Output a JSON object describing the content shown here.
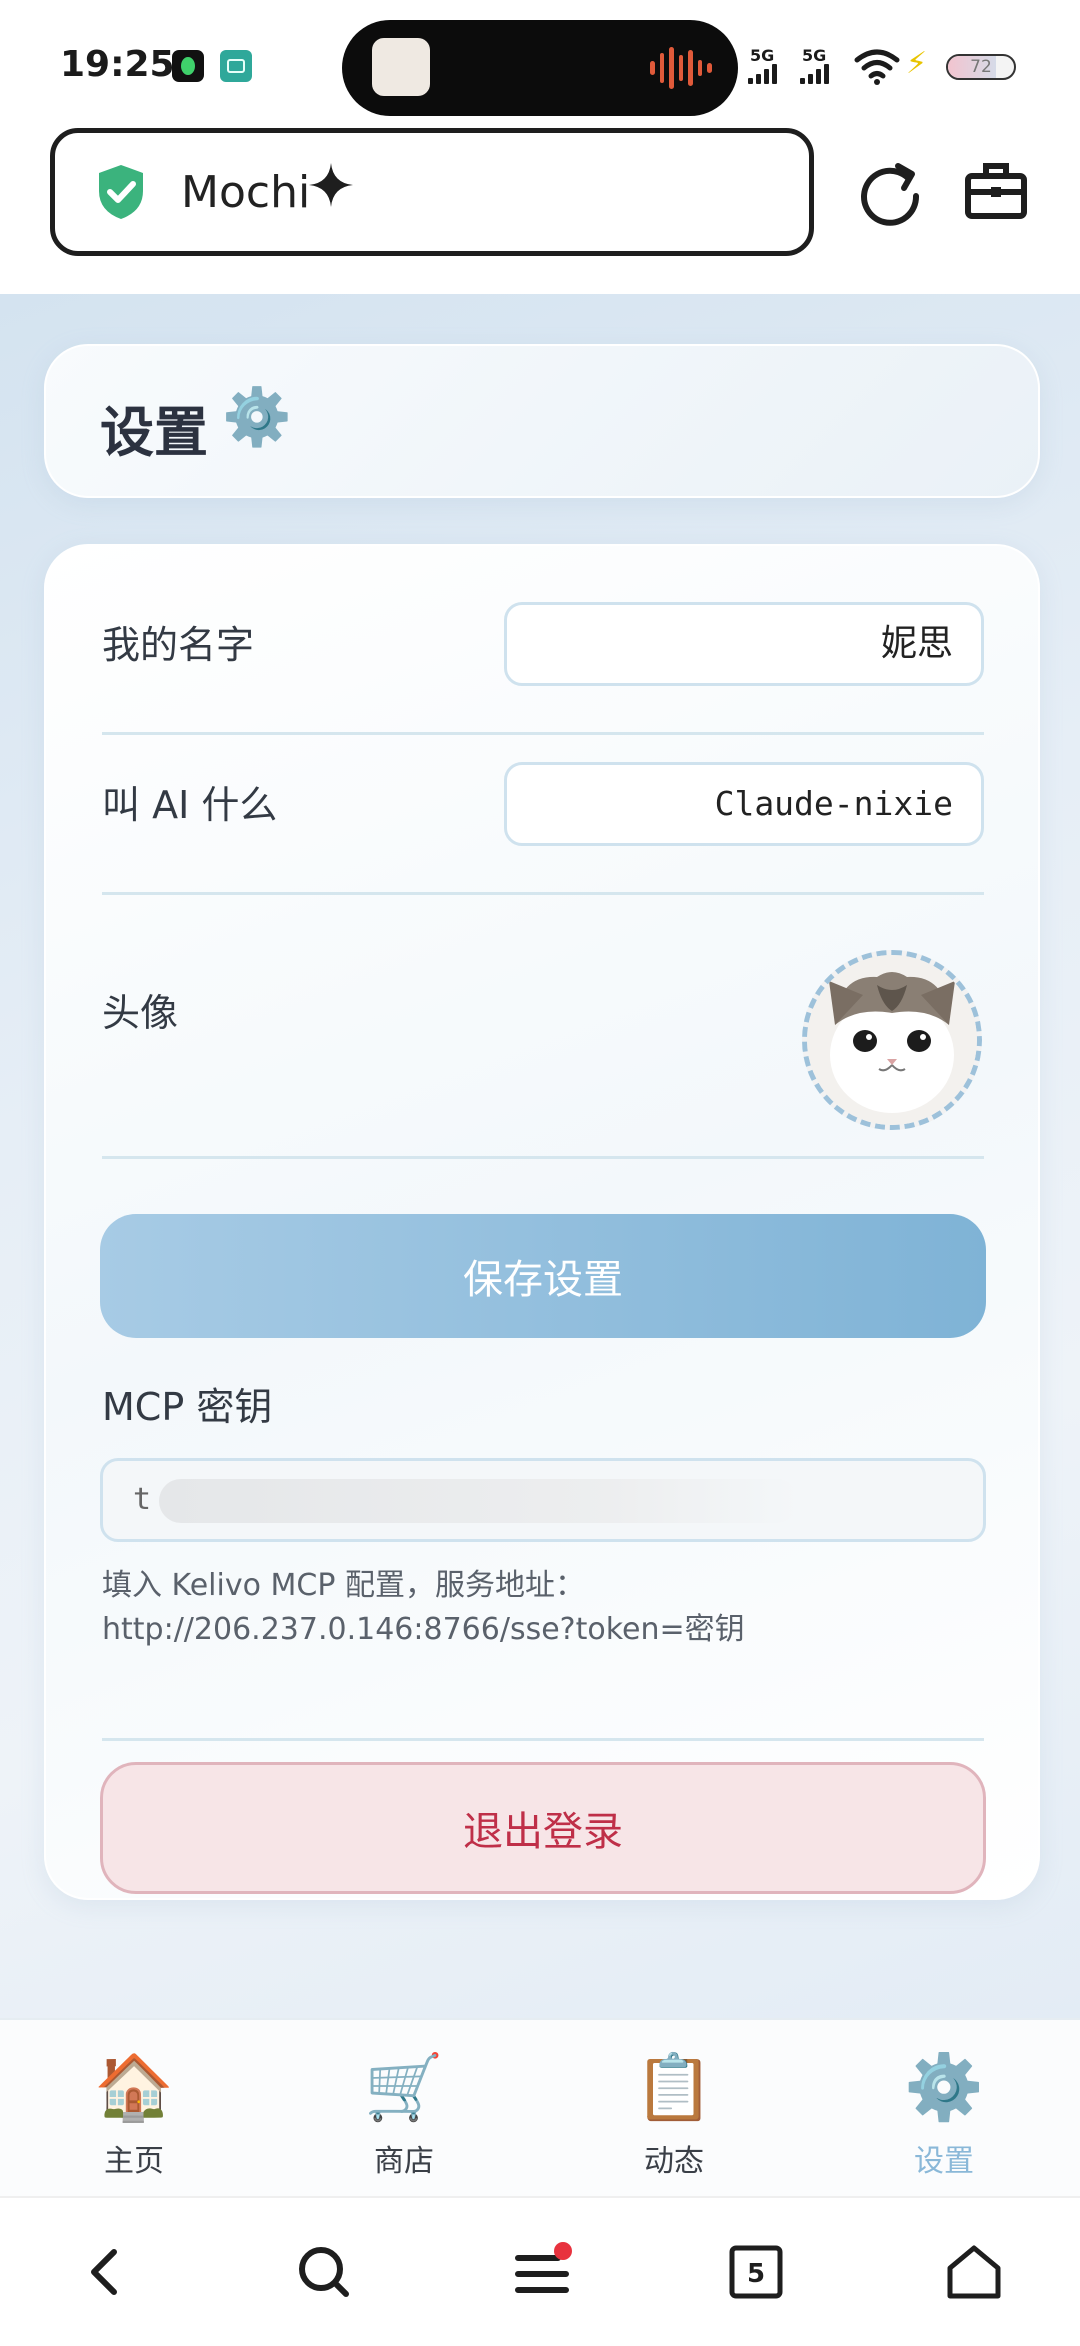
{
  "status_bar": {
    "time": "19:25",
    "signal_1": "5G",
    "signal_2": "5G",
    "battery": "72"
  },
  "browser": {
    "site_name": "Mochi",
    "security_icon": "shield-check-icon",
    "reload_icon": "reload-icon",
    "tools_icon": "toolbox-icon"
  },
  "page": {
    "title": "设置",
    "title_icon": "⚙️"
  },
  "settings": {
    "name_label": "我的名字",
    "name_value": "妮思",
    "ai_label": "叫 AI 什么",
    "ai_value": "Claude-nixie",
    "avatar_label": "头像",
    "save_button": "保存设置",
    "mcp_label": "MCP 密钥",
    "mcp_key_visible": "t",
    "mcp_hint_line1": "填入 Kelivo MCP 配置，服务地址：",
    "mcp_hint_line2": "http://206.237.0.146:8766/sse?token=密钥",
    "logout_button": "退出登录"
  },
  "tabbar": {
    "tabs": [
      {
        "label": "主页",
        "icon": "🏠"
      },
      {
        "label": "商店",
        "icon": "🛒"
      },
      {
        "label": "动态",
        "icon": "📋"
      },
      {
        "label": "设置",
        "icon": "⚙️"
      }
    ],
    "active_index": 3
  },
  "system_nav": {
    "tab_count": "5"
  },
  "colors": {
    "accent": "#8ab8d8",
    "save_button": "#7fb3d6",
    "logout_text": "#bf2f48",
    "logout_bg": "#f7e5e7"
  }
}
